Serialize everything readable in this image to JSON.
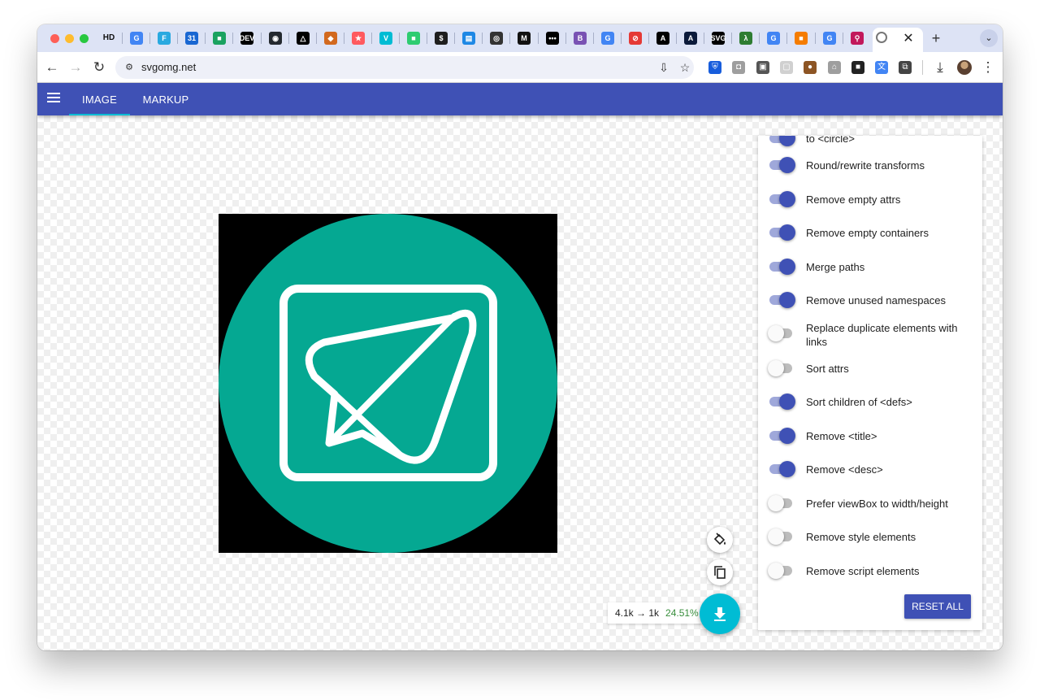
{
  "browser": {
    "tab_strip": {
      "first_favicon_text": "HD",
      "favicons": [
        {
          "name": "google-favicon",
          "text": "G",
          "color": "#4285f4"
        },
        {
          "name": "f-favicon",
          "text": "F",
          "color": "#29a9e0"
        },
        {
          "name": "calendar-favicon",
          "text": "31",
          "color": "#1967d2"
        },
        {
          "name": "green-square-favicon",
          "text": "■",
          "color": "#1aa260"
        },
        {
          "name": "dev-favicon",
          "text": "DEV",
          "color": "#000000"
        },
        {
          "name": "github-favicon",
          "text": "◉",
          "color": "#24292f"
        },
        {
          "name": "triangle-favicon",
          "text": "△",
          "color": "#000000"
        },
        {
          "name": "orange-favicon",
          "text": "◆",
          "color": "#d2691e"
        },
        {
          "name": "star-favicon",
          "text": "★",
          "color": "#ff5a5f"
        },
        {
          "name": "v-favicon",
          "text": "V",
          "color": "#00bcd4"
        },
        {
          "name": "green-favicon-2",
          "text": "■",
          "color": "#2ecc71"
        },
        {
          "name": "dollar-favicon",
          "text": "$",
          "color": "#1e1e1e"
        },
        {
          "name": "blue-doc-favicon",
          "text": "▤",
          "color": "#1e88e5"
        },
        {
          "name": "eye-favicon",
          "text": "◎",
          "color": "#333333"
        },
        {
          "name": "m-favicon",
          "text": "M",
          "color": "#111111"
        },
        {
          "name": "dots-favicon",
          "text": "•••",
          "color": "#000000"
        },
        {
          "name": "bootstrap-favicon",
          "text": "B",
          "color": "#7952b3"
        },
        {
          "name": "google-favicon-2",
          "text": "G",
          "color": "#4285f4"
        },
        {
          "name": "no-entry-favicon",
          "text": "⊘",
          "color": "#e53935"
        },
        {
          "name": "a-favicon",
          "text": "A",
          "color": "#000000"
        },
        {
          "name": "a-favicon-2",
          "text": "A",
          "color": "#0b1a3a"
        },
        {
          "name": "svg-favicon",
          "text": "SVG",
          "color": "#000000"
        },
        {
          "name": "lambda-favicon",
          "text": "λ",
          "color": "#2e7d32"
        },
        {
          "name": "google-favicon-3",
          "text": "G",
          "color": "#4285f4"
        },
        {
          "name": "orange-square-favicon",
          "text": "■",
          "color": "#f57c00"
        },
        {
          "name": "google-favicon-4",
          "text": "G",
          "color": "#4285f4"
        },
        {
          "name": "magnifier-favicon",
          "text": "⚲",
          "color": "#c2185b"
        }
      ],
      "close_glyph": "✕",
      "new_tab_glyph": "+",
      "tab_search_glyph": "⌄"
    },
    "toolbar": {
      "back_glyph": "←",
      "forward_glyph": "→",
      "reload_glyph": "↻",
      "site_info_glyph": "⚙",
      "url": "svgomg.net",
      "install_glyph": "⇩",
      "bookmark_glyph": "☆",
      "extensions": [
        {
          "name": "bitwarden-extension",
          "text": "⛨",
          "color": "#175ddc"
        },
        {
          "name": "camera-extension",
          "text": "◘",
          "color": "#9e9e9e"
        },
        {
          "name": "window-extension",
          "text": "▣",
          "color": "#555555"
        },
        {
          "name": "blank-extension",
          "text": "▢",
          "color": "#d0d0d0"
        },
        {
          "name": "cookie-extension",
          "text": "●",
          "color": "#8d5524"
        },
        {
          "name": "hat-extension",
          "text": "⌂",
          "color": "#9e9e9e"
        },
        {
          "name": "puzzle-dark-extension",
          "text": "■",
          "color": "#222222"
        },
        {
          "name": "translate-extension",
          "text": "文",
          "color": "#4285f4"
        },
        {
          "name": "extensions-menu",
          "text": "⧉",
          "color": "#444444"
        }
      ],
      "download_glyph": "⤓",
      "menu_glyph": "⋮"
    }
  },
  "app": {
    "tabs": [
      {
        "label": "IMAGE",
        "active": true
      },
      {
        "label": "MARKUP",
        "active": false
      }
    ],
    "settings": [
      {
        "label": "to <circle>",
        "on": true
      },
      {
        "label": "Round/rewrite transforms",
        "on": true
      },
      {
        "label": "Remove empty attrs",
        "on": true
      },
      {
        "label": "Remove empty containers",
        "on": true
      },
      {
        "label": "Merge paths",
        "on": true
      },
      {
        "label": "Remove unused namespaces",
        "on": true
      },
      {
        "label": "Replace duplicate elements with links",
        "on": false
      },
      {
        "label": "Sort attrs",
        "on": false
      },
      {
        "label": "Sort children of <defs>",
        "on": true
      },
      {
        "label": "Remove <title>",
        "on": true
      },
      {
        "label": "Remove <desc>",
        "on": true
      },
      {
        "label": "Prefer viewBox to width/height",
        "on": false
      },
      {
        "label": "Remove style elements",
        "on": false
      },
      {
        "label": "Remove script elements",
        "on": false
      }
    ],
    "reset_label": "RESET ALL",
    "size_text": "4.1k → 1k",
    "size_percent": "24.51%",
    "colors": {
      "primary": "#3f51b5",
      "accent": "#00bcd4",
      "teal_icon": "#05a892"
    }
  }
}
